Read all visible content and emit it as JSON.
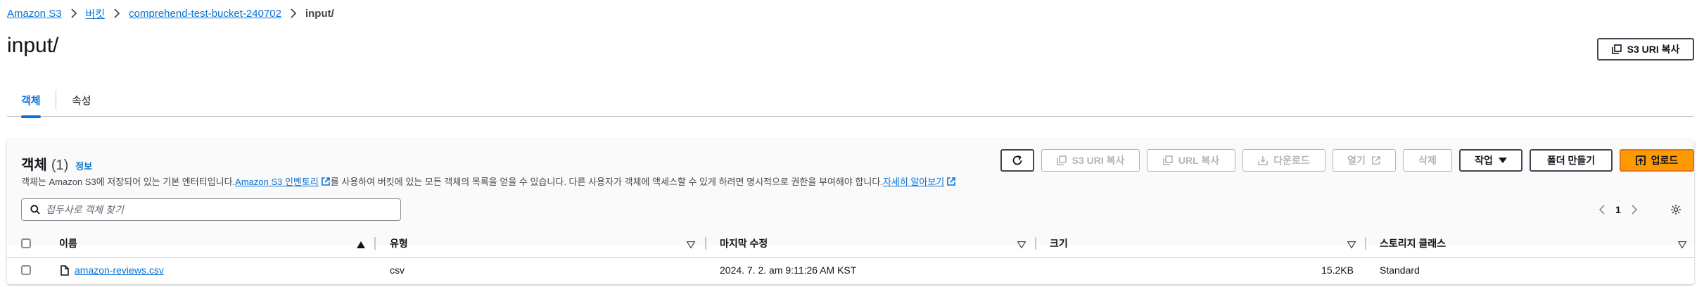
{
  "breadcrumb": {
    "items": [
      "Amazon S3",
      "버킷",
      "comprehend-test-bucket-240702"
    ],
    "current": "input/"
  },
  "header": {
    "title": "input/",
    "copy_uri_label": "S3 URI 복사"
  },
  "tabs": [
    {
      "label": "객체",
      "active": true
    },
    {
      "label": "속성",
      "active": false
    }
  ],
  "objects": {
    "title": "객체",
    "count": "(1)",
    "info_label": "정보",
    "description_prefix": "객체는 Amazon S3에 저장되어 있는 기본 엔터티입니다. ",
    "inventory_link": "Amazon S3 인벤토리",
    "description_middle": "를 사용하여 버킷에 있는 모든 객체의 목록을 얻을 수 있습니다. 다른 사용자가 객체에 액세스할 수 있게 하려면 명시적으로 권한을 부여해야 합니다. ",
    "learn_more_link": "자세히 알아보기",
    "toolbar": {
      "copy_s3_uri": "S3 URI 복사",
      "copy_url": "URL 복사",
      "download": "다운로드",
      "open": "열기",
      "delete": "삭제",
      "actions": "작업",
      "create_folder": "폴더 만들기",
      "upload": "업로드"
    },
    "search_placeholder": "접두사로 객체 찾기",
    "page": "1",
    "columns": [
      "이름",
      "유형",
      "마지막 수정",
      "크기",
      "스토리지 클래스"
    ],
    "rows": [
      {
        "name": "amazon-reviews.csv",
        "type": "csv",
        "modified": "2024. 7. 2. am 9:11:26 AM KST",
        "size": "15.2KB",
        "storage_class": "Standard"
      }
    ]
  },
  "colors": {
    "link": "#0972d3",
    "primary_button": "#ff9900",
    "primary_border": "#ec7211",
    "disabled": "#b4b4bb"
  }
}
